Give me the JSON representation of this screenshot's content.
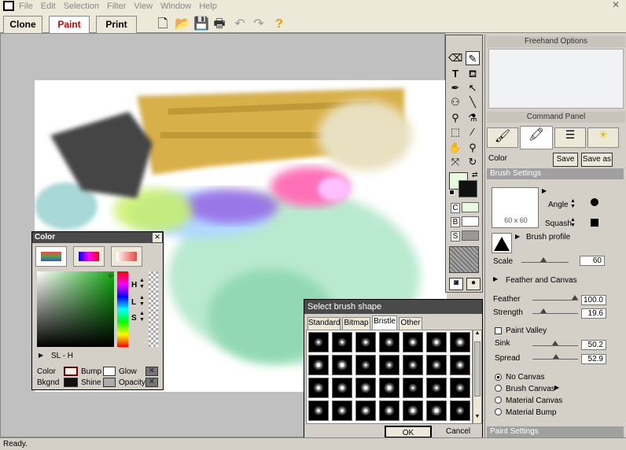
{
  "menu": [
    "File",
    "Edit",
    "Selection",
    "Filter",
    "View",
    "Window",
    "Help"
  ],
  "mode_tabs": [
    "Clone",
    "Paint",
    "Print"
  ],
  "active_tab": "Paint",
  "right_panel": {
    "freehand_title": "Freehand Options",
    "command_title": "Command Panel",
    "color_label": "Color",
    "save_label": "Save",
    "save_as_label": "Save as",
    "brush_settings": "Brush Settings",
    "brush_size": "60 x 60",
    "angle": "Angle",
    "squash": "Squash",
    "brush_profile": "Brush profile",
    "scale_label": "Scale",
    "scale_value": "60",
    "feather_canvas": "Feather and Canvas",
    "feather_label": "Feather",
    "feather_value": "100.0",
    "strength_label": "Strength",
    "strength_value": "19.6",
    "paint_valley": "Paint Valley",
    "sink_label": "Sink",
    "sink_value": "50.2",
    "spread_label": "Spread",
    "spread_value": "52.9",
    "canvas_options": [
      "No Canvas",
      "Brush Canvas",
      "Material Canvas",
      "Material Bump"
    ],
    "paint_settings": "Paint Settings"
  },
  "color_window": {
    "title": "Color",
    "h": "H",
    "l": "L",
    "s": "S",
    "mode": "SL - H",
    "color_lbl": "Color",
    "bkgnd_lbl": "Bkgnd",
    "bump_lbl": "Bump",
    "shine_lbl": "Shine",
    "glow_lbl": "Glow",
    "opacity_lbl": "Opacity"
  },
  "brush_window": {
    "title": "Select brush shape",
    "tabs": [
      "Standard",
      "Bitmap",
      "Bristle",
      "Other"
    ],
    "active_tab": "Bristle",
    "ok": "OK",
    "cancel": "Cancel"
  },
  "tool_letters": {
    "c": "C",
    "b": "B",
    "s": "S"
  },
  "status": "Ready."
}
